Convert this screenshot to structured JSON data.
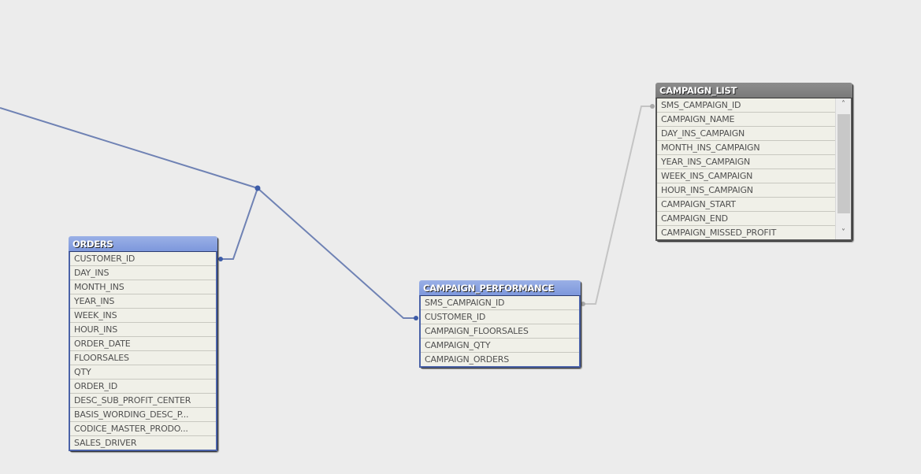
{
  "tables": {
    "orders": {
      "title": "ORDERS",
      "fields": [
        "CUSTOMER_ID",
        "DAY_INS",
        "MONTH_INS",
        "YEAR_INS",
        "WEEK_INS",
        "HOUR_INS",
        "ORDER_DATE",
        "FLOORSALES",
        "QTY",
        "ORDER_ID",
        "DESC_SUB_PROFIT_CENTER",
        "BASIS_WORDING_DESC_P...",
        "CODICE_MASTER_PRODO...",
        "SALES_DRIVER"
      ]
    },
    "campaign_performance": {
      "title": "CAMPAIGN_PERFORMANCE",
      "fields": [
        "SMS_CAMPAIGN_ID",
        "CUSTOMER_ID",
        "CAMPAIGN_FLOORSALES",
        "CAMPAIGN_QTY",
        "CAMPAIGN_ORDERS"
      ]
    },
    "campaign_list": {
      "title": "CAMPAIGN_LIST",
      "fields": [
        "SMS_CAMPAIGN_ID",
        "CAMPAIGN_NAME",
        "DAY_INS_CAMPAIGN",
        "MONTH_INS_CAMPAIGN",
        "YEAR_INS_CAMPAIGN",
        "WEEK_INS_CAMPAIGN",
        "HOUR_INS_CAMPAIGN",
        "CAMPAIGN_START",
        "CAMPAIGN_END",
        "CAMPAIGN_MISSED_PROFIT"
      ],
      "scroll": {
        "up_icon": "chevron-up-icon",
        "down_icon": "chevron-down-icon"
      }
    }
  },
  "links": {
    "customer_id_color": "#6f82b4",
    "sms_campaign_id_color": "#c4c4c4"
  },
  "colors": {
    "canvas": "#ececec",
    "active_header": "#8aa2e0",
    "inactive_header": "#848484",
    "row_bg": "#f0f0e8"
  }
}
